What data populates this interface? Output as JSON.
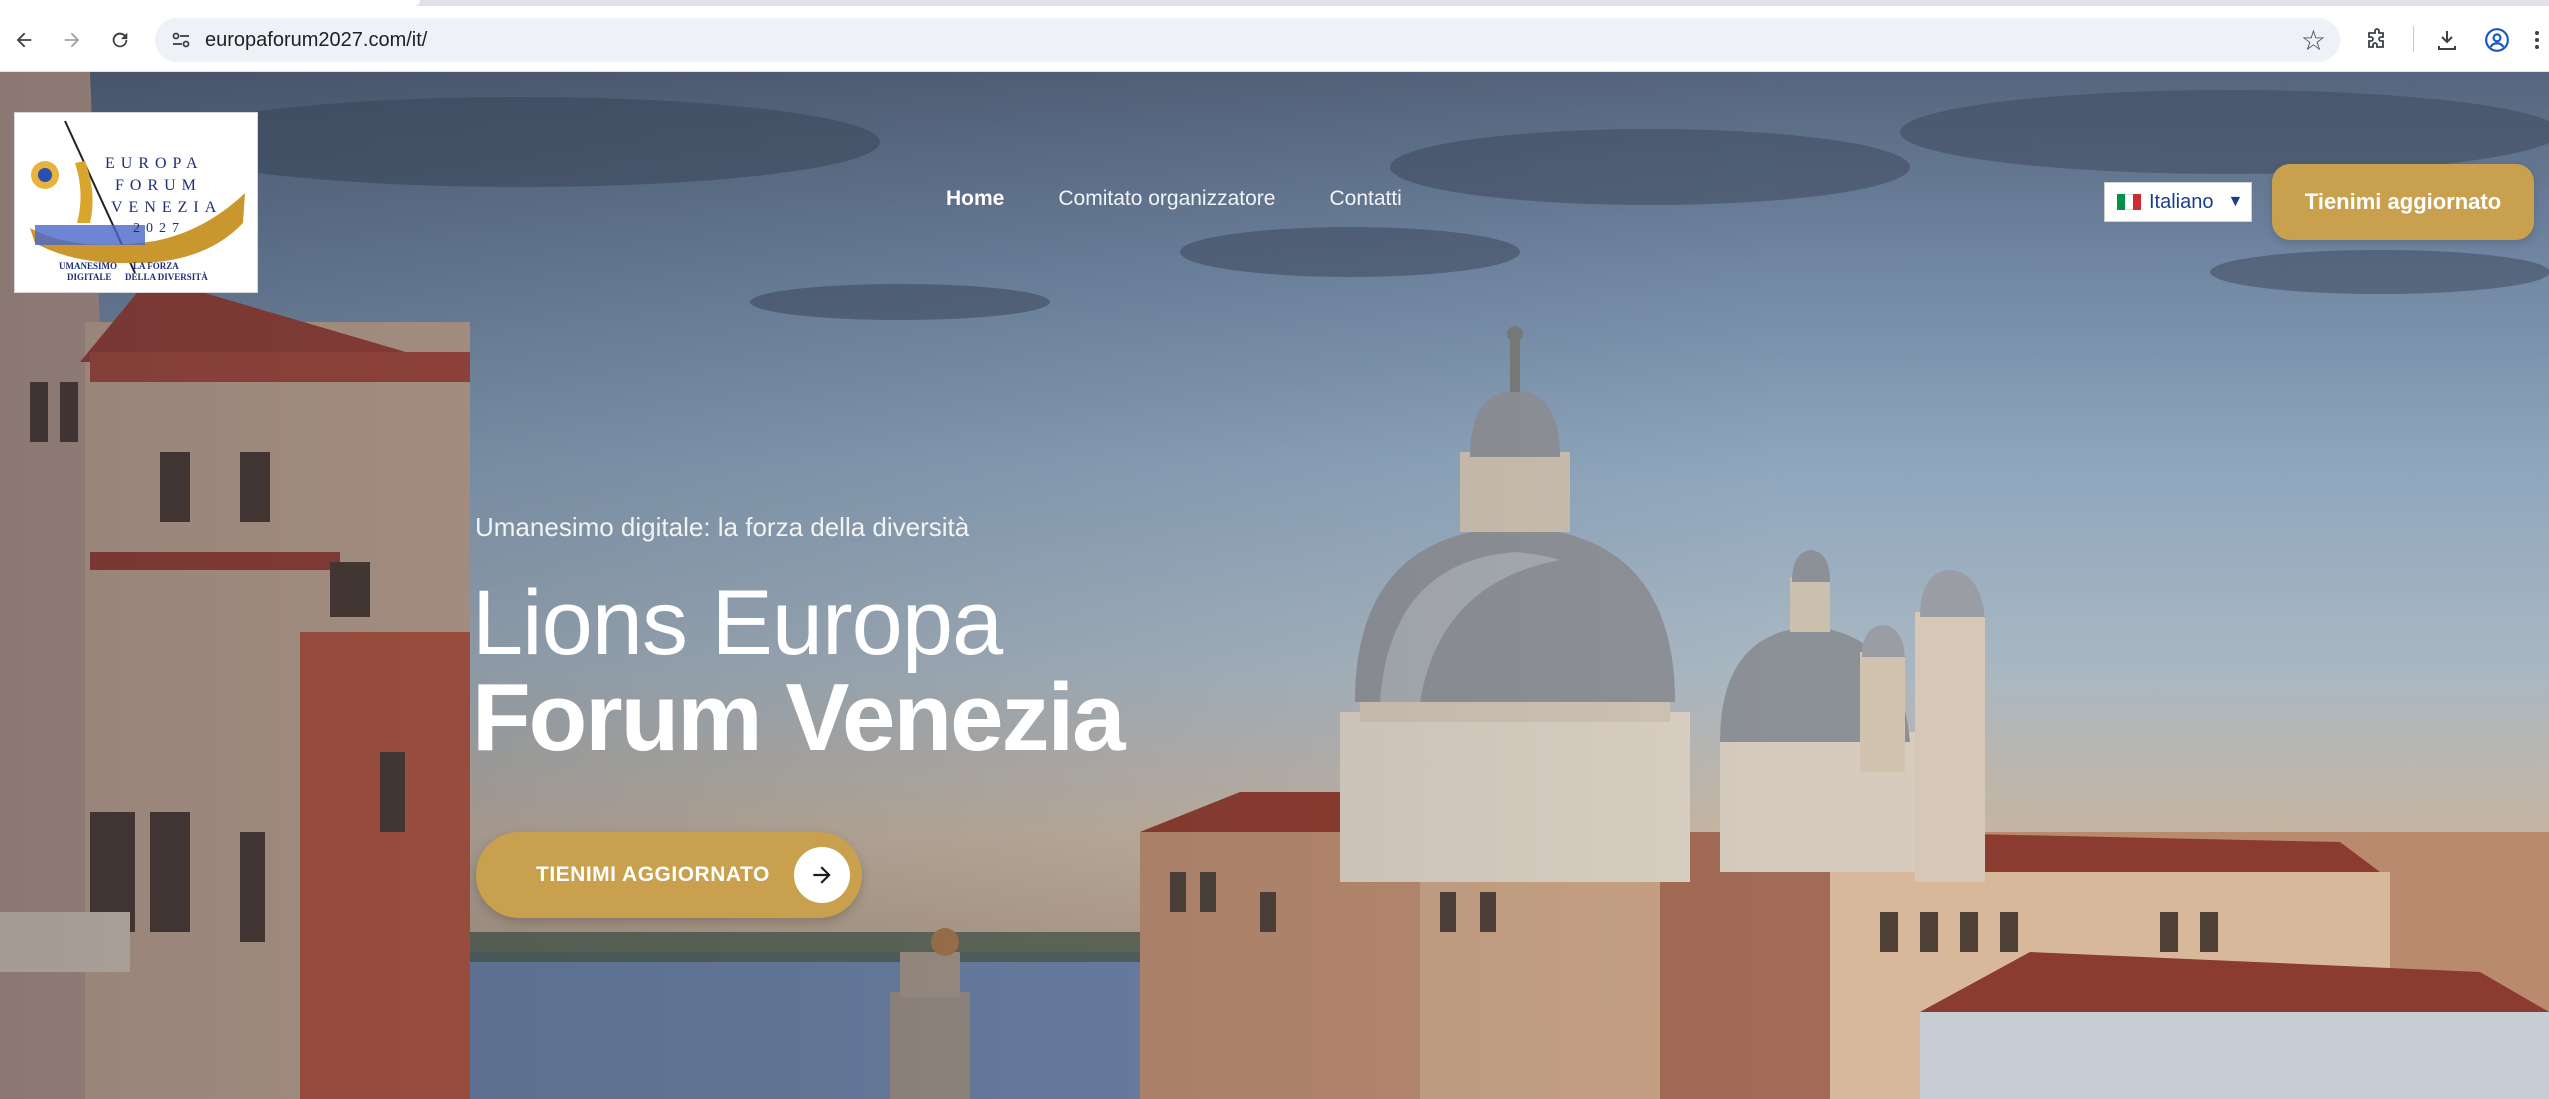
{
  "browser": {
    "url": "europaforum2027.com/it/",
    "icons": {
      "back": "arrow-left-icon",
      "forward": "arrow-right-icon",
      "reload": "reload-icon",
      "site_info": "tune-icon",
      "bookmark": "star-icon",
      "extensions": "puzzle-icon",
      "download": "download-icon",
      "profile": "profile-icon",
      "menu": "more-vertical-icon"
    }
  },
  "logo": {
    "line1": "EUROPA",
    "line2": "FORUM",
    "line3": "VENEZIA",
    "line4": "2027",
    "tag_left": "UMANESIMO",
    "tag_left2": "DIGITALE",
    "tag_right": "LA FORZA",
    "tag_right2": "DELLA DIVERSITÀ"
  },
  "nav": {
    "items": [
      {
        "label": "Home",
        "active": true
      },
      {
        "label": "Comitato organizzatore",
        "active": false
      },
      {
        "label": "Contatti",
        "active": false
      }
    ]
  },
  "language": {
    "selected": "Italiano",
    "flag_colors": [
      "#009246",
      "#ffffff",
      "#ce2b37"
    ]
  },
  "cta_top": {
    "label": "Tienimi aggiornato"
  },
  "hero": {
    "subtitle": "Umanesimo digitale: la forza della diversità",
    "title_line1": "Lions Europa",
    "title_line2": "Forum Venezia",
    "cta_label": "TIENIMI AGGIORNATO"
  },
  "colors": {
    "accent_gold": "#c9a04e",
    "link_blue": "#1a3e8f",
    "logo_blue": "#1c2e7a"
  }
}
